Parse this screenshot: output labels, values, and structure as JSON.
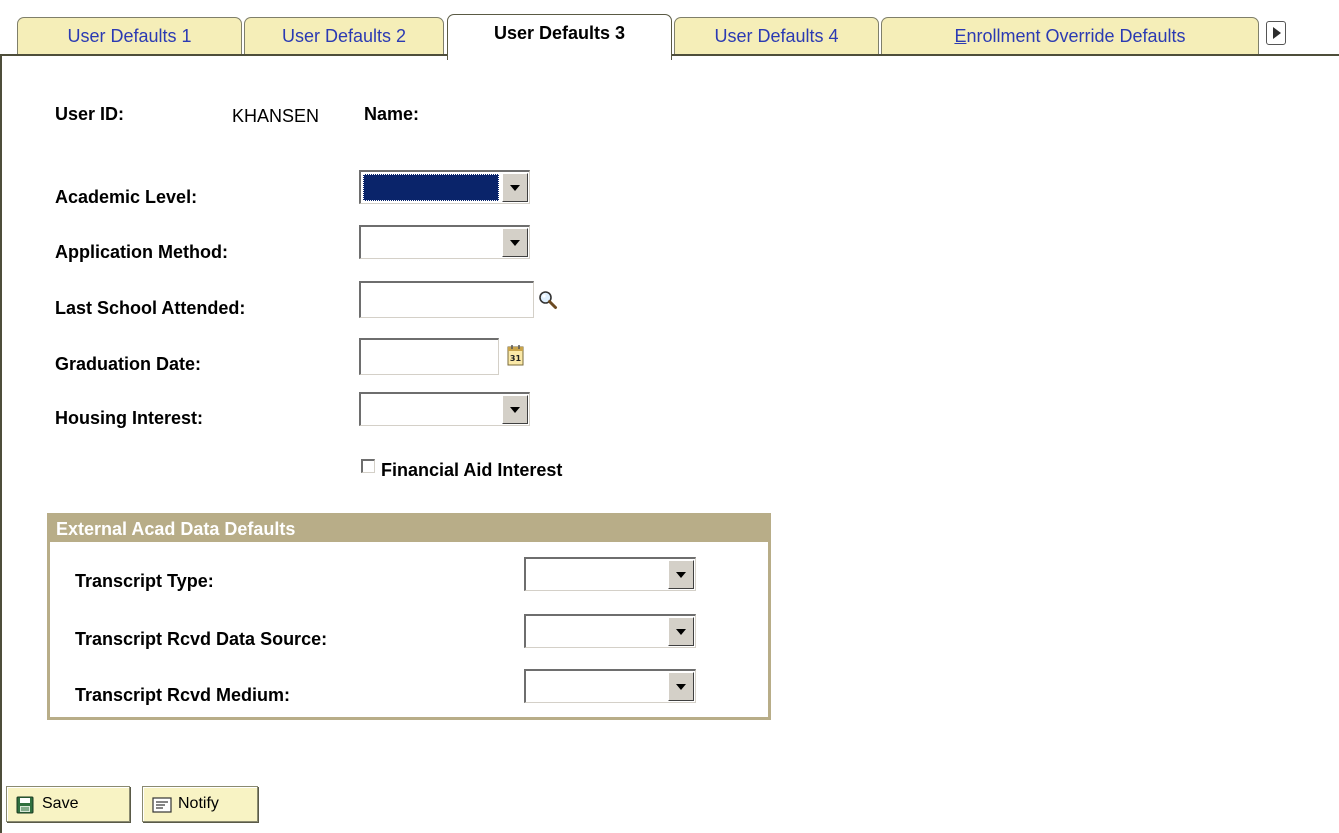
{
  "tabs": [
    {
      "label": "User Defaults 1",
      "active": false
    },
    {
      "label": "User Defaults 2",
      "active": false
    },
    {
      "label": "User Defaults 3",
      "active": true
    },
    {
      "label": "User Defaults 4",
      "active": false
    },
    {
      "label_prefix": "E",
      "label_rest": "nrollment Override Defaults",
      "active": false
    }
  ],
  "header": {
    "user_id_label": "User ID:",
    "user_id_value": "KHANSEN",
    "name_label": "Name:",
    "name_value": ""
  },
  "form": {
    "academic_level_label": "Academic Level:",
    "academic_level_value": "",
    "application_method_label": "Application Method:",
    "application_method_value": "",
    "last_school_label": "Last School Attended:",
    "last_school_value": "",
    "graduation_date_label": "Graduation Date:",
    "graduation_date_value": "",
    "calendar_day": "31",
    "housing_interest_label": "Housing Interest:",
    "housing_interest_value": "",
    "financial_aid_label": "Financial Aid Interest",
    "financial_aid_checked": false
  },
  "external_group": {
    "title": "External Acad Data Defaults",
    "transcript_type_label": "Transcript Type:",
    "transcript_type_value": "",
    "transcript_source_label": "Transcript Rcvd Data Source:",
    "transcript_source_value": "",
    "transcript_medium_label": "Transcript Rcvd Medium:",
    "transcript_medium_value": ""
  },
  "buttons": {
    "save_label": "Save",
    "notify_label": "Notify"
  },
  "colors": {
    "tab_bg": "#f5eeb8",
    "tab_text": "#2b3ab3",
    "group_header": "#b8ad88",
    "selection": "#0a246a",
    "button_bg": "#f8f3c4"
  }
}
